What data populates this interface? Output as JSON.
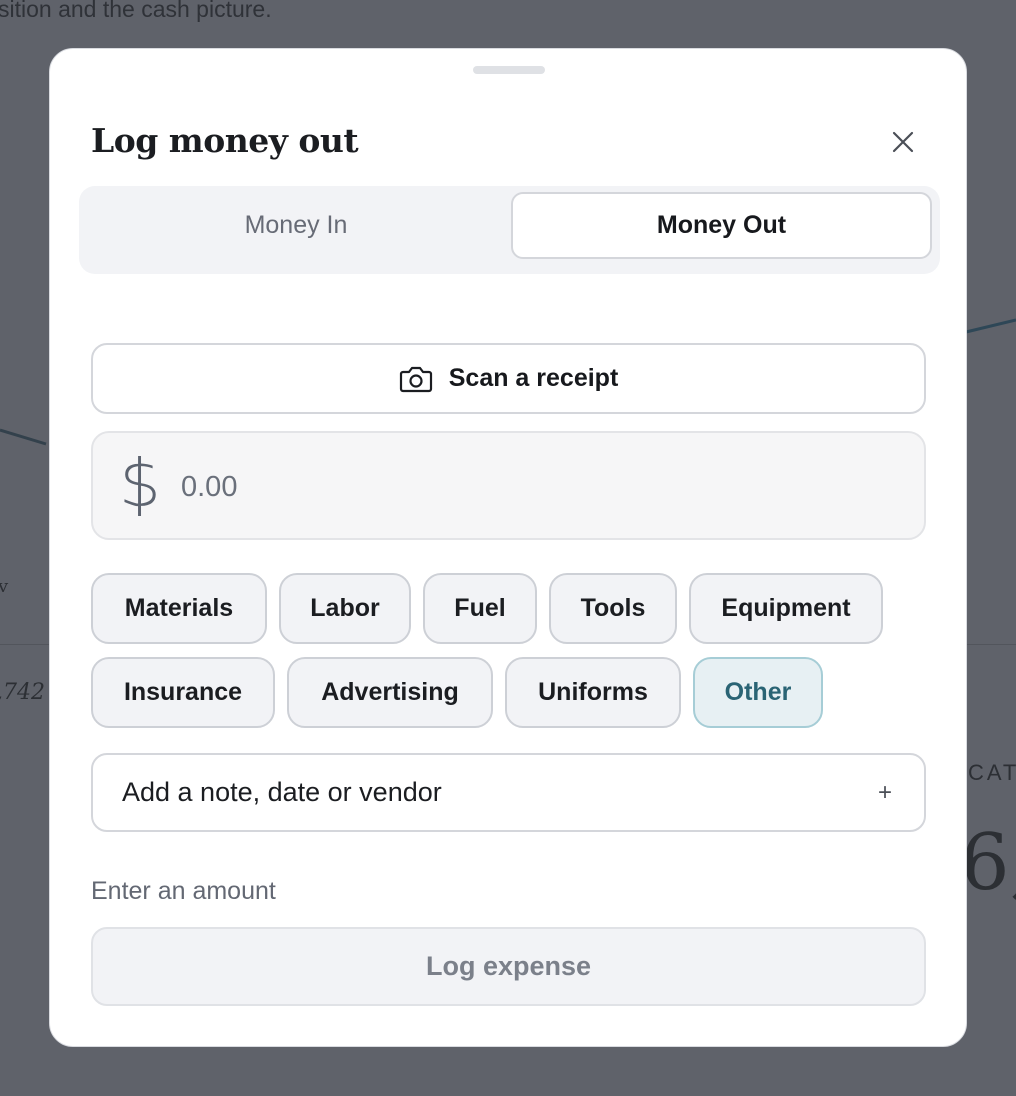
{
  "background": {
    "subtitle_fragment": "sition and the cash picture.",
    "fragment_v": "v",
    "fragment_number": ",742",
    "fragment_category": "CAT",
    "fragment_big_number": "6,"
  },
  "modal": {
    "title": "Log money out",
    "close_icon": "close-icon",
    "tabs": [
      {
        "label": "Money In",
        "active": false
      },
      {
        "label": "Money Out",
        "active": true
      }
    ],
    "scan_receipt": {
      "label": "Scan a receipt",
      "icon": "camera-icon"
    },
    "amount": {
      "currency_symbol": "$",
      "placeholder": "0.00",
      "value": ""
    },
    "categories": [
      {
        "label": "Materials",
        "selected": false
      },
      {
        "label": "Labor",
        "selected": false
      },
      {
        "label": "Fuel",
        "selected": false
      },
      {
        "label": "Tools",
        "selected": false
      },
      {
        "label": "Equipment",
        "selected": false
      },
      {
        "label": "Insurance",
        "selected": false
      },
      {
        "label": "Advertising",
        "selected": false
      },
      {
        "label": "Uniforms",
        "selected": false
      },
      {
        "label": "Other",
        "selected": true
      }
    ],
    "note": {
      "label": "Add a note, date or vendor",
      "action_symbol": "+"
    },
    "hint": "Enter an amount",
    "submit_label": "Log expense",
    "colors": {
      "accent": "#2a6474",
      "selected_chip_bg": "#e7f0f3",
      "overlay": "#5f626a"
    }
  }
}
